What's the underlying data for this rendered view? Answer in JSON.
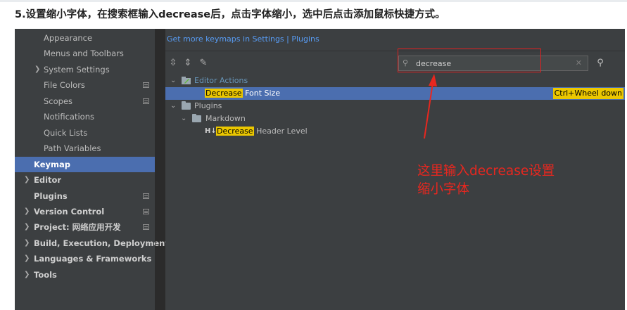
{
  "caption": "5.设置缩小字体，在搜索框输入decrease后，点击字体缩小，选中后点击添加鼠标快捷方式。",
  "colors": {
    "accent": "#4b6eaf",
    "highlight": "#ebc700",
    "annotation": "#e8271f",
    "link": "#589df6"
  },
  "sidebar": {
    "items": [
      {
        "label": "Appearance"
      },
      {
        "label": "Menus and Toolbars"
      },
      {
        "label": "System Settings"
      },
      {
        "label": "File Colors"
      },
      {
        "label": "Scopes"
      },
      {
        "label": "Notifications"
      },
      {
        "label": "Quick Lists"
      },
      {
        "label": "Path Variables"
      },
      {
        "label": "Keymap"
      },
      {
        "label": "Editor"
      },
      {
        "label": "Plugins"
      },
      {
        "label": "Version Control"
      },
      {
        "label": "Project: 网络应用开发"
      },
      {
        "label": "Build, Execution, Deployment"
      },
      {
        "label": "Languages & Frameworks"
      },
      {
        "label": "Tools"
      }
    ]
  },
  "content": {
    "link": "Get more keymaps in Settings | Plugins",
    "toolbar_icons": [
      "expand-all-icon",
      "collapse-all-icon",
      "edit-icon"
    ],
    "search": {
      "value": "decrease",
      "icon": "search-icon",
      "clear_icon": "clear-icon",
      "find_icon": "find-shortcut-icon"
    },
    "tree": {
      "editor_actions": "Editor Actions",
      "decrease_match": "Decrease",
      "font_size_rest": " Font Size",
      "shortcut": "Ctrl+Wheel down",
      "plugins": "Plugins",
      "markdown": "Markdown",
      "md_icon": "H↓",
      "header_match": "Decrease",
      "header_rest": " Header Level"
    }
  },
  "annotation": {
    "line1": "这里输入decrease设置",
    "line2": "缩小字体"
  }
}
